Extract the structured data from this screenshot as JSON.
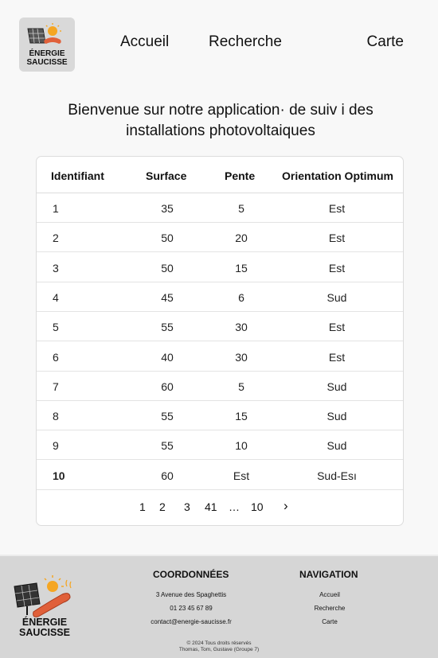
{
  "header": {
    "logo_text": "ÉNERGIE SAUCISSE",
    "nav": {
      "accueil": "Accueil",
      "recherche": "Recherche",
      "carte": "Carte"
    }
  },
  "welcome": {
    "line1": "Bienvenue sur notre application· de suiv i des",
    "line2": "installations photovoltaiques"
  },
  "table": {
    "columns": [
      "Identifiant",
      "Surface",
      "Pente",
      "Orientation Optimum"
    ],
    "rows": [
      [
        "1",
        "35",
        "5",
        "Est"
      ],
      [
        "2",
        "50",
        "20",
        "Est"
      ],
      [
        "3",
        "50",
        "15",
        "Est"
      ],
      [
        "4",
        "45",
        "6",
        "Sud"
      ],
      [
        "5",
        "55",
        "30",
        "Est"
      ],
      [
        "6",
        "40",
        "30",
        "Est"
      ],
      [
        "7",
        "60",
        "5",
        "Sud"
      ],
      [
        "8",
        "55",
        "15",
        "Sud"
      ],
      [
        "9",
        "55",
        "10",
        "Sud"
      ],
      [
        "10",
        "60",
        "Est",
        "Sud-Esı"
      ]
    ]
  },
  "pagination": {
    "pages": [
      "1",
      "2",
      "3",
      "41",
      "…",
      "10"
    ],
    "next": "›"
  },
  "footer": {
    "logo_text_line1": "ÉNERGIE",
    "logo_text_line2": "SAUCISSE",
    "coord_title": "COORDONNÉES",
    "address": "3 Avenue des Spaghettis",
    "phone": "01 23 45 67 89",
    "email": "contact@energie-saucisse.fr",
    "nav_title": "NAVIGATION",
    "nav_links": [
      "Accueil",
      "Recherche",
      "Carte"
    ],
    "copyright": "©  2024 Tous droits réservés",
    "authors": "Thomas, Tom, Gustave  (Groupe 7)"
  },
  "colors": {
    "sun": "#f5a623",
    "sausage": "#e0603a",
    "footer_bg": "#d6d6d6"
  }
}
